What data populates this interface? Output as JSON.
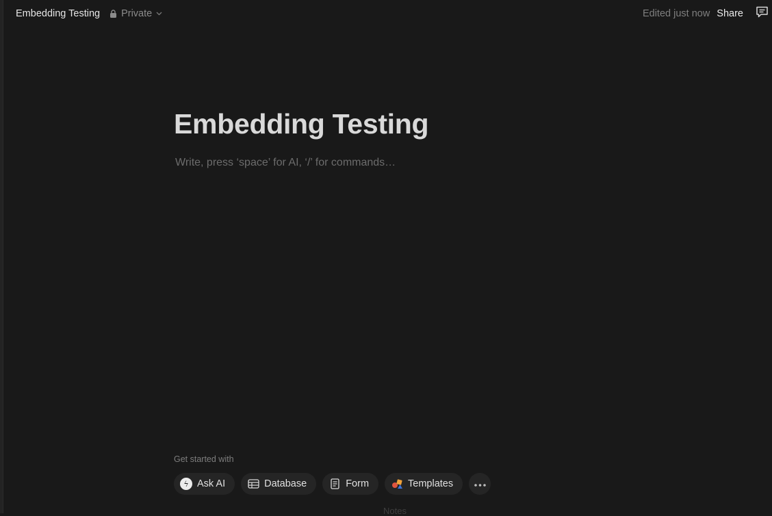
{
  "topbar": {
    "page_name": "Embedding Testing",
    "privacy_label": "Private",
    "edited_status": "Edited just now",
    "share_label": "Share",
    "icons": [
      "lock-icon",
      "chevron-down-icon",
      "comment-icon"
    ]
  },
  "editor": {
    "title": "Embedding Testing",
    "placeholder": "Write, press ‘space’ for AI, ‘/’ for commands…"
  },
  "get_started": {
    "heading": "Get started with",
    "chips": [
      {
        "label": "Ask AI",
        "icon": "ai-face-icon"
      },
      {
        "label": "Database",
        "icon": "table-icon"
      },
      {
        "label": "Form",
        "icon": "document-icon"
      },
      {
        "label": "Templates",
        "icon": "templates-shapes-icon"
      }
    ],
    "more_icon": "ellipsis-icon"
  },
  "bottom_hint": "Notes",
  "colors": {
    "background": "#191919",
    "chip_bg": "#252525",
    "text_primary": "#e0e0e0",
    "text_muted": "#7f7f7f"
  }
}
